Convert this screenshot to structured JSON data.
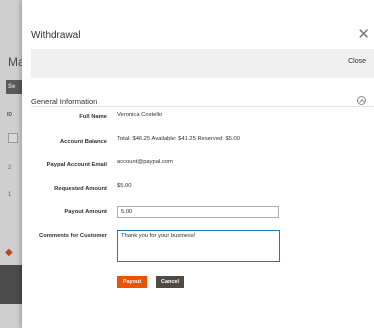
{
  "background": {
    "title": "Ma",
    "button_label": "Se",
    "id_header": "ID",
    "row_values": [
      "2",
      "1"
    ]
  },
  "modal": {
    "title": "Withdrawal",
    "close_label": "Close",
    "section_title": "General Information"
  },
  "form": {
    "full_name_label": "Full Name",
    "full_name_value": "Veronica Costello",
    "account_balance_label": "Account Balance",
    "account_balance_value": "Total: $46.25 Available: $41.25 Reserved: $5.00",
    "paypal_email_label": "Paypal Account Email",
    "paypal_email_value": "account@paypal.com",
    "requested_amount_label": "Requested Amount",
    "requested_amount_value": "$5.00",
    "payout_amount_label": "Payout Amount",
    "payout_amount_value": "5.00",
    "comments_label": "Comments for Customer",
    "comments_value": "Thank you for your business!"
  },
  "actions": {
    "payout_label": "Payout",
    "cancel_label": "Cancel"
  },
  "colors": {
    "payout_button": "#eb5202",
    "cancel_button": "#514943",
    "focus_border": "#1979c3"
  }
}
